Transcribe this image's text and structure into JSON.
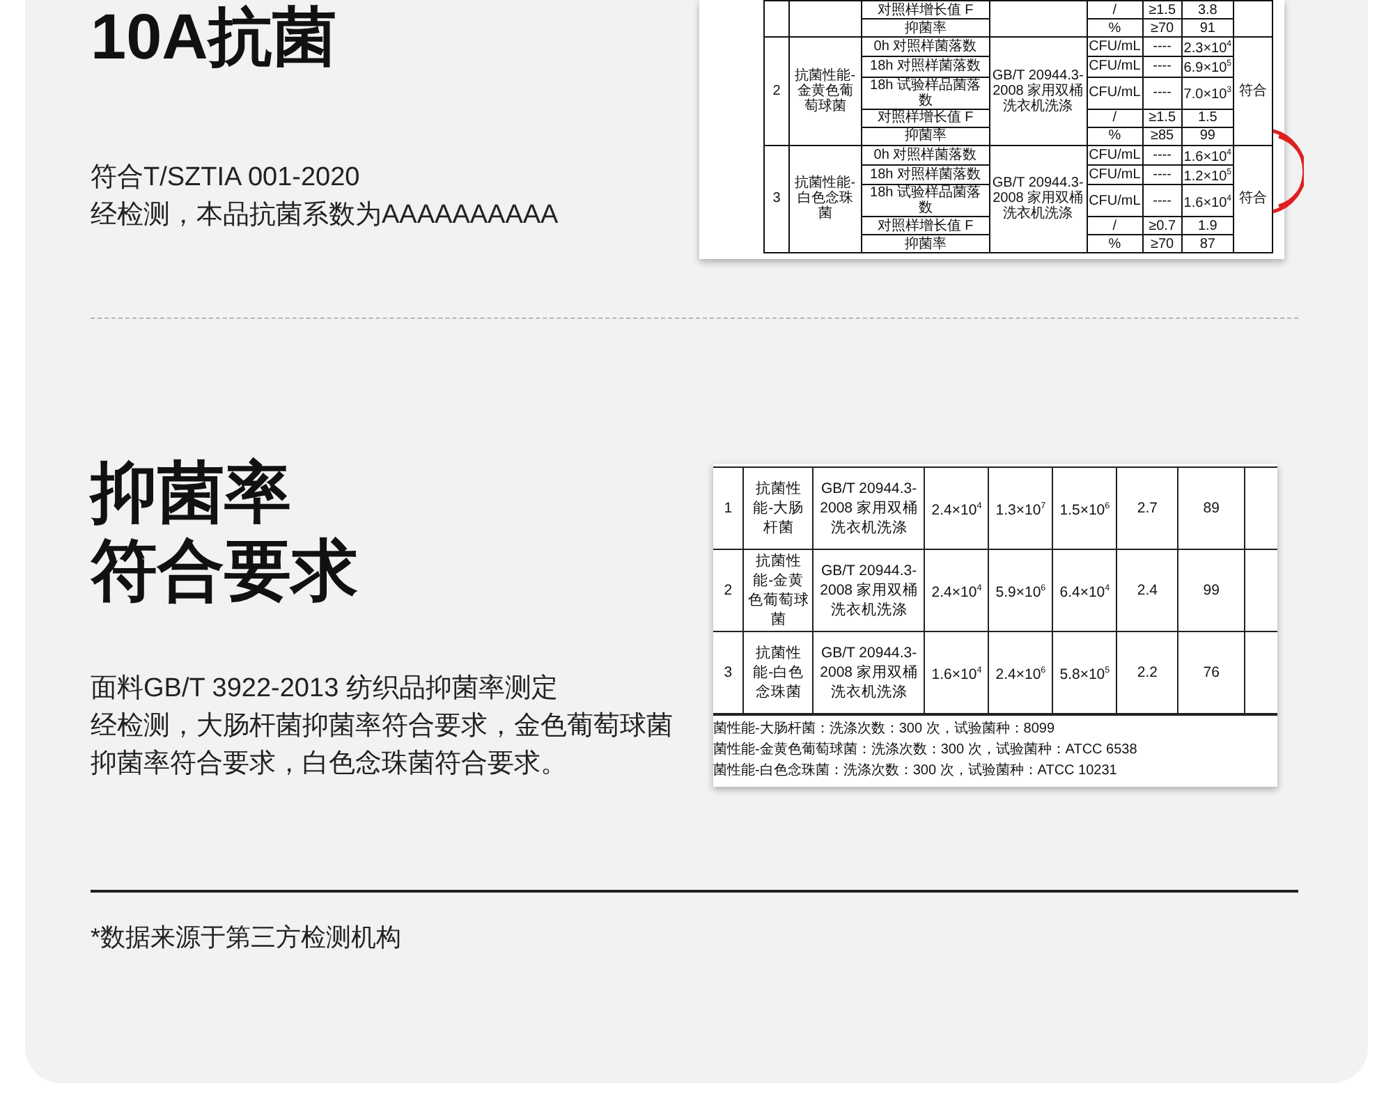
{
  "section_1": {
    "title": "10A抗菌",
    "lines": [
      "符合T/SZTIA 001-2020",
      "经检测，本品抗菌系数为AAAAAAAAAA"
    ],
    "report_table": {
      "groups": [
        {
          "rows": [
            {
              "item": "对照样增长值 F",
              "unit": "/",
              "requirement": "≥1.5",
              "result": "3.8"
            },
            {
              "item": "抑菌率",
              "unit": "%",
              "requirement": "≥70",
              "result": "91"
            }
          ]
        },
        {
          "no": "2",
          "name": "抗菌性能-金黄色葡萄球菌",
          "method": "GB/T 20944.3-2008 家用双桶洗衣机洗涤",
          "verdict": "符合",
          "rows": [
            {
              "item": "0h 对照样菌落数",
              "unit": "CFU/mL",
              "requirement": "----",
              "result": "2.3×10$^{4}$"
            },
            {
              "item": "18h 对照样菌落数",
              "unit": "CFU/mL",
              "requirement": "----",
              "result": "6.9×10$^{5}$"
            },
            {
              "item": "18h 试验样品菌落数",
              "unit": "CFU/mL",
              "requirement": "----",
              "result": "7.0×10$^{3}$"
            },
            {
              "item": "对照样增长值 F",
              "unit": "/",
              "requirement": "≥1.5",
              "result": "1.5"
            },
            {
              "item": "抑菌率",
              "unit": "%",
              "requirement": "≥85",
              "result": "99"
            }
          ]
        },
        {
          "no": "3",
          "name": "抗菌性能-白色念珠菌",
          "method": "GB/T 20944.3-2008 家用双桶洗衣机洗涤",
          "verdict": "符合",
          "rows": [
            {
              "item": "0h 对照样菌落数",
              "unit": "CFU/mL",
              "requirement": "----",
              "result": "1.6×10$^{4}$"
            },
            {
              "item": "18h 对照样菌落数",
              "unit": "CFU/mL",
              "requirement": "----",
              "result": "1.2×10$^{5}$"
            },
            {
              "item": "18h 试验样品菌落数",
              "unit": "CFU/mL",
              "requirement": "----",
              "result": "1.6×10$^{4}$"
            },
            {
              "item": "对照样增长值 F",
              "unit": "/",
              "requirement": "≥0.7",
              "result": "1.9"
            },
            {
              "item": "抑菌率",
              "unit": "%",
              "requirement": "≥70",
              "result": "87"
            }
          ]
        }
      ]
    }
  },
  "section_2": {
    "title_lines": [
      "抑菌率",
      "符合要求"
    ],
    "lines": [
      "面料GB/T 3922-2013 纺织品抑菌率测定",
      "经检测，大肠杆菌抑菌率符合要求，金色葡萄球菌",
      "抑菌率符合要求，白色念珠菌符合要求。"
    ],
    "report_table": {
      "rows": [
        {
          "no": "1",
          "name": "抗菌性能-大肠杆菌",
          "method": "GB/T 20944.3-2008 家用双桶洗衣机洗涤",
          "values": [
            "2.4×10$^{4}$",
            "1.3×10$^{7}$",
            "1.5×10$^{6}$",
            "2.7",
            "89"
          ]
        },
        {
          "no": "2",
          "name": "抗菌性能-金黄色葡萄球菌",
          "method": "GB/T 20944.3-2008 家用双桶洗衣机洗涤",
          "values": [
            "2.4×10$^{4}$",
            "5.9×10$^{6}$",
            "6.4×10$^{4}$",
            "2.4",
            "99"
          ]
        },
        {
          "no": "3",
          "name": "抗菌性能-白色念珠菌",
          "method": "GB/T 20944.3-2008 家用双桶洗衣机洗涤",
          "values": [
            "1.6×10$^{4}$",
            "2.4×10$^{6}$",
            "5.8×10$^{5}$",
            "2.2",
            "76"
          ]
        }
      ],
      "notes": [
        "菌性能-大肠杆菌：洗涤次数：300 次，试验菌种：8099",
        "菌性能-金黄色葡萄球菌：洗涤次数：300 次，试验菌种：ATCC 6538",
        "菌性能-白色念珠菌：洗涤次数：300 次，试验菌种：ATCC 10231"
      ]
    }
  },
  "footnote": "*数据来源于第三方检测机构"
}
